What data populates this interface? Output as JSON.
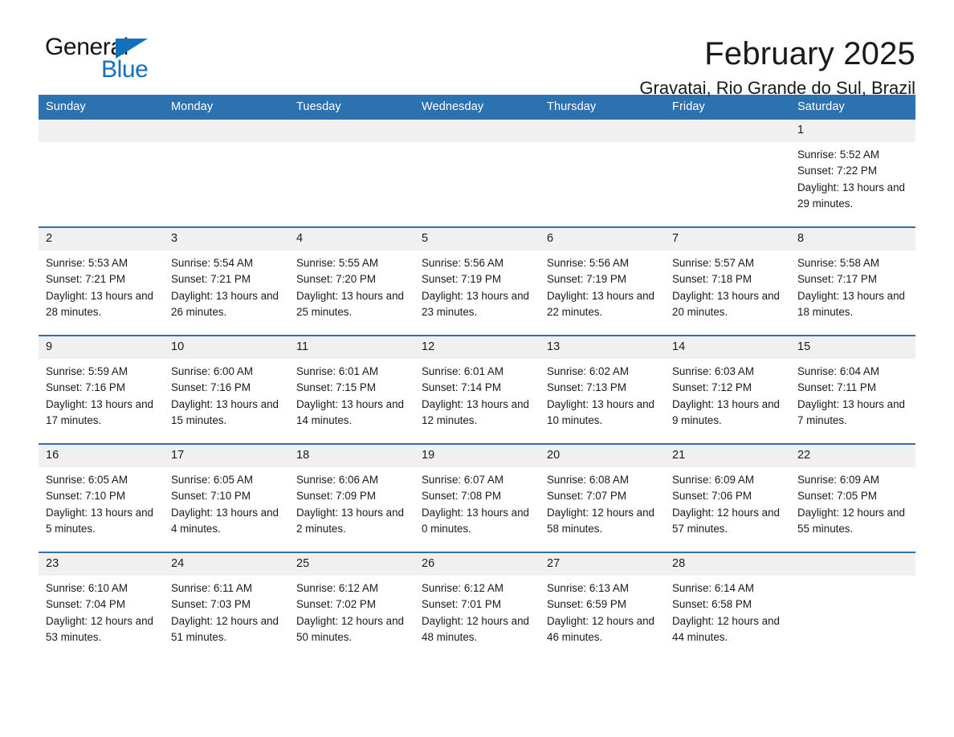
{
  "brand": {
    "name_part1": "General",
    "name_part2": "Blue",
    "accent_color": "#1270bd"
  },
  "header": {
    "month_title": "February 2025",
    "location": "Gravatai, Rio Grande do Sul, Brazil",
    "header_bg_color": "#2d72b0",
    "daynum_bg_color": "#f0f0f0"
  },
  "weekdays": [
    "Sunday",
    "Monday",
    "Tuesday",
    "Wednesday",
    "Thursday",
    "Friday",
    "Saturday"
  ],
  "weeks": [
    [
      {
        "day": ""
      },
      {
        "day": ""
      },
      {
        "day": ""
      },
      {
        "day": ""
      },
      {
        "day": ""
      },
      {
        "day": ""
      },
      {
        "day": "1",
        "sunrise": "Sunrise: 5:52 AM",
        "sunset": "Sunset: 7:22 PM",
        "daylight": "Daylight: 13 hours and 29 minutes."
      }
    ],
    [
      {
        "day": "2",
        "sunrise": "Sunrise: 5:53 AM",
        "sunset": "Sunset: 7:21 PM",
        "daylight": "Daylight: 13 hours and 28 minutes."
      },
      {
        "day": "3",
        "sunrise": "Sunrise: 5:54 AM",
        "sunset": "Sunset: 7:21 PM",
        "daylight": "Daylight: 13 hours and 26 minutes."
      },
      {
        "day": "4",
        "sunrise": "Sunrise: 5:55 AM",
        "sunset": "Sunset: 7:20 PM",
        "daylight": "Daylight: 13 hours and 25 minutes."
      },
      {
        "day": "5",
        "sunrise": "Sunrise: 5:56 AM",
        "sunset": "Sunset: 7:19 PM",
        "daylight": "Daylight: 13 hours and 23 minutes."
      },
      {
        "day": "6",
        "sunrise": "Sunrise: 5:56 AM",
        "sunset": "Sunset: 7:19 PM",
        "daylight": "Daylight: 13 hours and 22 minutes."
      },
      {
        "day": "7",
        "sunrise": "Sunrise: 5:57 AM",
        "sunset": "Sunset: 7:18 PM",
        "daylight": "Daylight: 13 hours and 20 minutes."
      },
      {
        "day": "8",
        "sunrise": "Sunrise: 5:58 AM",
        "sunset": "Sunset: 7:17 PM",
        "daylight": "Daylight: 13 hours and 18 minutes."
      }
    ],
    [
      {
        "day": "9",
        "sunrise": "Sunrise: 5:59 AM",
        "sunset": "Sunset: 7:16 PM",
        "daylight": "Daylight: 13 hours and 17 minutes."
      },
      {
        "day": "10",
        "sunrise": "Sunrise: 6:00 AM",
        "sunset": "Sunset: 7:16 PM",
        "daylight": "Daylight: 13 hours and 15 minutes."
      },
      {
        "day": "11",
        "sunrise": "Sunrise: 6:01 AM",
        "sunset": "Sunset: 7:15 PM",
        "daylight": "Daylight: 13 hours and 14 minutes."
      },
      {
        "day": "12",
        "sunrise": "Sunrise: 6:01 AM",
        "sunset": "Sunset: 7:14 PM",
        "daylight": "Daylight: 13 hours and 12 minutes."
      },
      {
        "day": "13",
        "sunrise": "Sunrise: 6:02 AM",
        "sunset": "Sunset: 7:13 PM",
        "daylight": "Daylight: 13 hours and 10 minutes."
      },
      {
        "day": "14",
        "sunrise": "Sunrise: 6:03 AM",
        "sunset": "Sunset: 7:12 PM",
        "daylight": "Daylight: 13 hours and 9 minutes."
      },
      {
        "day": "15",
        "sunrise": "Sunrise: 6:04 AM",
        "sunset": "Sunset: 7:11 PM",
        "daylight": "Daylight: 13 hours and 7 minutes."
      }
    ],
    [
      {
        "day": "16",
        "sunrise": "Sunrise: 6:05 AM",
        "sunset": "Sunset: 7:10 PM",
        "daylight": "Daylight: 13 hours and 5 minutes."
      },
      {
        "day": "17",
        "sunrise": "Sunrise: 6:05 AM",
        "sunset": "Sunset: 7:10 PM",
        "daylight": "Daylight: 13 hours and 4 minutes."
      },
      {
        "day": "18",
        "sunrise": "Sunrise: 6:06 AM",
        "sunset": "Sunset: 7:09 PM",
        "daylight": "Daylight: 13 hours and 2 minutes."
      },
      {
        "day": "19",
        "sunrise": "Sunrise: 6:07 AM",
        "sunset": "Sunset: 7:08 PM",
        "daylight": "Daylight: 13 hours and 0 minutes."
      },
      {
        "day": "20",
        "sunrise": "Sunrise: 6:08 AM",
        "sunset": "Sunset: 7:07 PM",
        "daylight": "Daylight: 12 hours and 58 minutes."
      },
      {
        "day": "21",
        "sunrise": "Sunrise: 6:09 AM",
        "sunset": "Sunset: 7:06 PM",
        "daylight": "Daylight: 12 hours and 57 minutes."
      },
      {
        "day": "22",
        "sunrise": "Sunrise: 6:09 AM",
        "sunset": "Sunset: 7:05 PM",
        "daylight": "Daylight: 12 hours and 55 minutes."
      }
    ],
    [
      {
        "day": "23",
        "sunrise": "Sunrise: 6:10 AM",
        "sunset": "Sunset: 7:04 PM",
        "daylight": "Daylight: 12 hours and 53 minutes."
      },
      {
        "day": "24",
        "sunrise": "Sunrise: 6:11 AM",
        "sunset": "Sunset: 7:03 PM",
        "daylight": "Daylight: 12 hours and 51 minutes."
      },
      {
        "day": "25",
        "sunrise": "Sunrise: 6:12 AM",
        "sunset": "Sunset: 7:02 PM",
        "daylight": "Daylight: 12 hours and 50 minutes."
      },
      {
        "day": "26",
        "sunrise": "Sunrise: 6:12 AM",
        "sunset": "Sunset: 7:01 PM",
        "daylight": "Daylight: 12 hours and 48 minutes."
      },
      {
        "day": "27",
        "sunrise": "Sunrise: 6:13 AM",
        "sunset": "Sunset: 6:59 PM",
        "daylight": "Daylight: 12 hours and 46 minutes."
      },
      {
        "day": "28",
        "sunrise": "Sunrise: 6:14 AM",
        "sunset": "Sunset: 6:58 PM",
        "daylight": "Daylight: 12 hours and 44 minutes."
      },
      {
        "day": ""
      }
    ]
  ]
}
